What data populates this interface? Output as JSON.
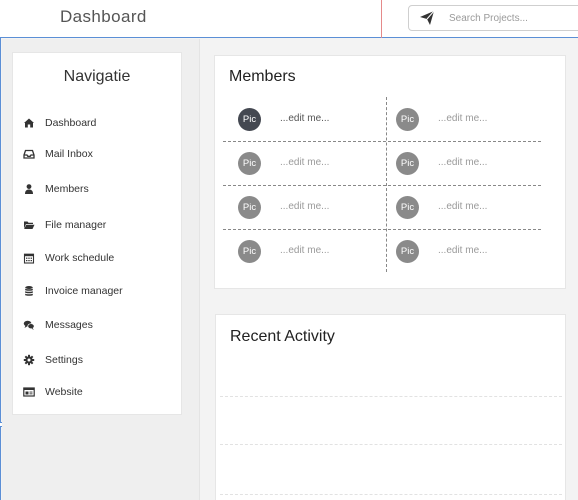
{
  "header": {
    "title": "Dashboard",
    "search": {
      "placeholder": "Search Projects...",
      "value": ""
    },
    "send_icon": "paper-plane-icon"
  },
  "sidebar": {
    "title": "Navigatie",
    "items": [
      {
        "label": "Dashboard",
        "icon": "home-icon"
      },
      {
        "label": "Mail Inbox",
        "icon": "inbox-icon"
      },
      {
        "label": "Members",
        "icon": "user-icon"
      },
      {
        "label": "File manager",
        "icon": "folder-open-icon"
      },
      {
        "label": "Work schedule",
        "icon": "calendar-icon"
      },
      {
        "label": "Invoice manager",
        "icon": "database-icon"
      },
      {
        "label": "Messages",
        "icon": "comments-icon"
      },
      {
        "label": "Settings",
        "icon": "gear-icon"
      },
      {
        "label": "Website",
        "icon": "browser-icon"
      }
    ]
  },
  "members": {
    "title": "Members",
    "list": [
      {
        "pic": "Pic",
        "name": "...edit me..."
      },
      {
        "pic": "Pic",
        "name": "...edit me..."
      },
      {
        "pic": "Pic",
        "name": "...edit me..."
      },
      {
        "pic": "Pic",
        "name": "...edit me..."
      },
      {
        "pic": "Pic",
        "name": "...edit me..."
      },
      {
        "pic": "Pic",
        "name": "...edit me..."
      },
      {
        "pic": "Pic",
        "name": "...edit me..."
      },
      {
        "pic": "Pic",
        "name": "...edit me..."
      }
    ]
  },
  "activity": {
    "title": "Recent Activity"
  },
  "colors": {
    "header_border": "#5b8fd6",
    "header_divider": "#e58a8a",
    "pic_badge": "#8a8a8a",
    "pic_badge_active": "#444851",
    "page_background": "#f3f3f3"
  }
}
